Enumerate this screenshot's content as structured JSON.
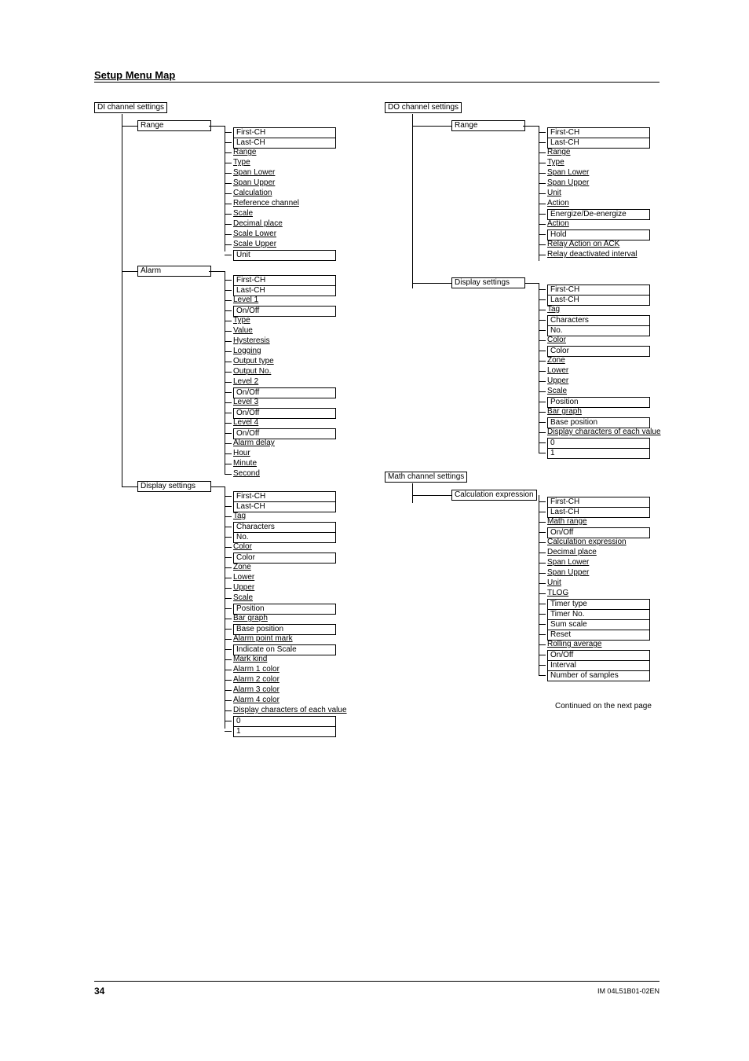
{
  "heading": "Setup Menu Map",
  "footer": {
    "page": "34",
    "docid": "IM 04L51B01-02EN"
  },
  "note_continued": "Continued on the next page",
  "di": {
    "root": "DI channel settings",
    "nodes": {
      "range": {
        "label": "Range",
        "items": [
          "First-CH",
          "Last-CH",
          "Range",
          "Type",
          "Span Lower",
          "Span Upper",
          "Calculation",
          "Reference channel",
          "Scale",
          "Decimal place",
          "Scale Lower",
          "Scale Upper",
          "Unit"
        ],
        "underlined_idx": [
          2,
          3,
          4,
          5,
          6,
          7,
          8,
          9,
          10,
          11
        ]
      },
      "alarm": {
        "label": "Alarm",
        "items": [
          "First-CH",
          "Last-CH",
          "Level 1",
          "On/Off",
          "Type",
          "Value",
          "Hysteresis",
          "Logging",
          "Output type",
          "Output No.",
          "Level 2",
          "On/Off",
          "Level 3",
          "On/Off",
          "Level 4",
          "On/Off",
          "Alarm delay",
          "Hour",
          "Minute",
          "Second"
        ],
        "underlined_idx": [
          2,
          4,
          5,
          6,
          7,
          8,
          9,
          10,
          12,
          14,
          16,
          17,
          18,
          19
        ],
        "boxed_idx": [
          0,
          1,
          3,
          11,
          13,
          15
        ]
      },
      "display": {
        "label": "Display settings",
        "items": [
          "First-CH",
          "Last-CH",
          "Tag",
          "Characters",
          "No.",
          "Color",
          "Color",
          "Zone",
          "Lower",
          "Upper",
          "Scale",
          "Position",
          "Bar graph",
          "Base position",
          "Alarm point mark",
          "Indicate on Scale",
          "Mark kind",
          "Alarm 1 color",
          "Alarm 2 color",
          "Alarm 3 color",
          "Alarm 4 color",
          "Display characters of each value",
          "0",
          "1"
        ],
        "underlined_idx": [
          2,
          5,
          7,
          8,
          9,
          10,
          12,
          14,
          16,
          17,
          18,
          19,
          20,
          21
        ],
        "boxed_idx": [
          0,
          1,
          3,
          4,
          6,
          11,
          13,
          15,
          22,
          23
        ]
      }
    }
  },
  "do": {
    "root": "DO channel settings",
    "nodes": {
      "range": {
        "label": "Range",
        "items": [
          "First-CH",
          "Last-CH",
          "Range",
          "Type",
          "Span Lower",
          "Span Upper",
          "Unit",
          "Action",
          "Energize/De-energize",
          "Action",
          "Hold",
          "Relay Action on ACK",
          "Relay deactivated interval"
        ],
        "underlined_idx": [
          2,
          3,
          4,
          5,
          6,
          7,
          9,
          11,
          12
        ],
        "boxed_idx": [
          0,
          1,
          8,
          10
        ]
      },
      "display": {
        "label": "Display settings",
        "items": [
          "First-CH",
          "Last-CH",
          "Tag",
          "Characters",
          "No.",
          "Color",
          "Color",
          "Zone",
          "Lower",
          "Upper",
          "Scale",
          "Position",
          "Bar graph",
          "Base position",
          "Display characters of each value",
          "0",
          "1"
        ],
        "underlined_idx": [
          2,
          5,
          7,
          8,
          9,
          10,
          12,
          14
        ],
        "boxed_idx": [
          0,
          1,
          3,
          4,
          6,
          11,
          13,
          15,
          16
        ]
      }
    }
  },
  "math": {
    "root": "Math channel settings",
    "nodes": {
      "calc": {
        "label": "Calculation expression",
        "items": [
          "First-CH",
          "Last-CH",
          "Math range",
          "On/Off",
          "Calculation expression",
          "Decimal place",
          "Span Lower",
          "Span Upper",
          "Unit",
          "TLOG",
          "Timer type",
          "Timer No.",
          "Sum scale",
          "Reset",
          "Rolling average",
          "On/Off",
          "Interval",
          "Number of samples"
        ],
        "underlined_idx": [
          2,
          4,
          5,
          6,
          7,
          8,
          9,
          14
        ],
        "boxed_idx": [
          0,
          1,
          3,
          10,
          11,
          12,
          13,
          15,
          16,
          17
        ]
      }
    }
  }
}
